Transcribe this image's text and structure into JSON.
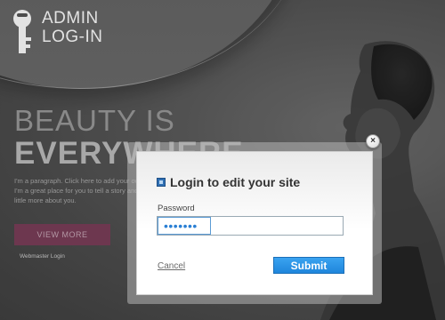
{
  "header": {
    "logo_line1": "ADMIN",
    "logo_line2": "LOG-IN",
    "logo_icon": "key-icon"
  },
  "hero": {
    "line1": "BEAUTY IS",
    "line2": "EVERYWHERE",
    "paragraph": [
      "I'm a paragraph. Click here to add your own",
      "I'm a great place for you to tell a story and",
      "little more about you."
    ],
    "view_more_label": "VIEW MORE",
    "webmaster_label": "Webmaster Login"
  },
  "modal": {
    "title": "Login to edit your site",
    "password_label": "Password",
    "password_value": "•••••••",
    "cancel_label": "Cancel",
    "submit_label": "Submit",
    "close_symbol": "×"
  },
  "colors": {
    "view_more_bg": "#7a3d58",
    "submit_bg": "#1f86dc",
    "input_focus": "#5b9bd5"
  }
}
